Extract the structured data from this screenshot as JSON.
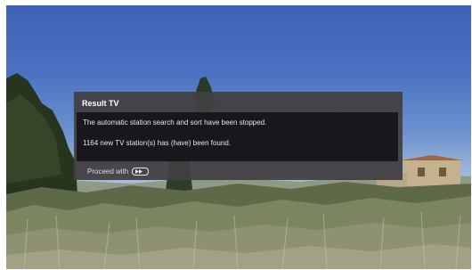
{
  "dialog": {
    "title": "Result TV",
    "message_1": "The automatic station search and sort have been stopped.",
    "message_2": "1164 new TV station(s) has (have) been found.",
    "footer_label": "Proceed with",
    "proceed_icon": "fast-forward-button-icon"
  },
  "colors": {
    "dialog_frame": "#424042",
    "dialog_body": "#19171b",
    "sky_top": "#3f62b6",
    "sky_horizon": "#b8c8d8"
  }
}
